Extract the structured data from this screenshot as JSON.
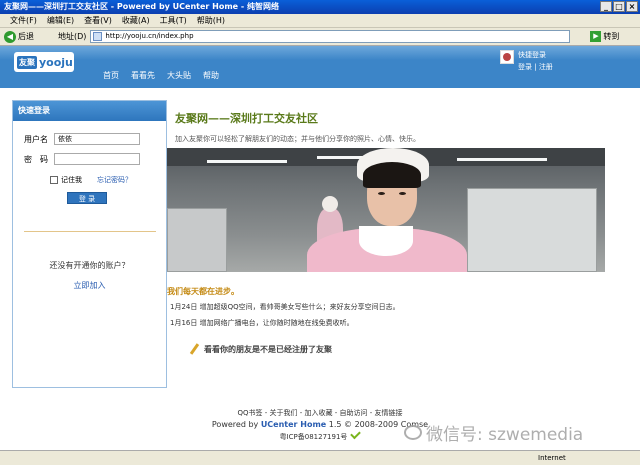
{
  "window": {
    "title": "友聚网——深圳打工交友社区 - Powered by UCenter Home - 纯智网络",
    "controls": [
      "_",
      "□",
      "×"
    ]
  },
  "menu": [
    "文件(F)",
    "编辑(E)",
    "查看(V)",
    "收藏(A)",
    "工具(T)",
    "帮助(H)"
  ],
  "toolbar": {
    "back_label": "后退",
    "address_label": "地址(D)",
    "address_value": "http://yooju.cn/index.php",
    "go_label": "转到"
  },
  "site": {
    "logo_cn": "友聚",
    "logo_en": "yooju",
    "nav": [
      "首页",
      "看看先",
      "大头贴",
      "帮助"
    ],
    "user_links": {
      "quick_login": "快捷登录",
      "register": "注册",
      "login": "登录"
    }
  },
  "sidebar": {
    "header": "快速登录",
    "username_label": "用户名",
    "username_value": "依依",
    "password_label": "密　码",
    "remember_label": "记住我",
    "forgot_label": "忘记密码？",
    "login_button": "登 录",
    "no_account": "还没有开通你的账户？",
    "signup": "立即加入"
  },
  "main": {
    "title": "友聚网——深圳打工交友社区",
    "desc": "加入友聚你可以轻松了解朋友们的动态；并与他们分享你的照片、心情、快乐。",
    "news_title": "我们每天都在进步。",
    "news": [
      "1月24日 增加超级QQ空间，看帅哥美女写些什么；来好友分享空间日志。",
      "1月16日 增加网络广播电台，让你随时随地在线免费收听。"
    ],
    "friends_link": "看看你的朋友是不是已经注册了友聚"
  },
  "footer": {
    "links": "QQ书签 - 关于我们 - 加入收藏 - 自助访问 - 友情链接",
    "powered_prefix": "Powered by",
    "powered_brand": "UCenter Home",
    "powered_suffix": "1.5 © 2008-2009 Comse",
    "icp": "粤ICP备08127191号"
  },
  "watermark": "微信号: szwemedia",
  "status": {
    "text": "",
    "zone": "Internet"
  }
}
